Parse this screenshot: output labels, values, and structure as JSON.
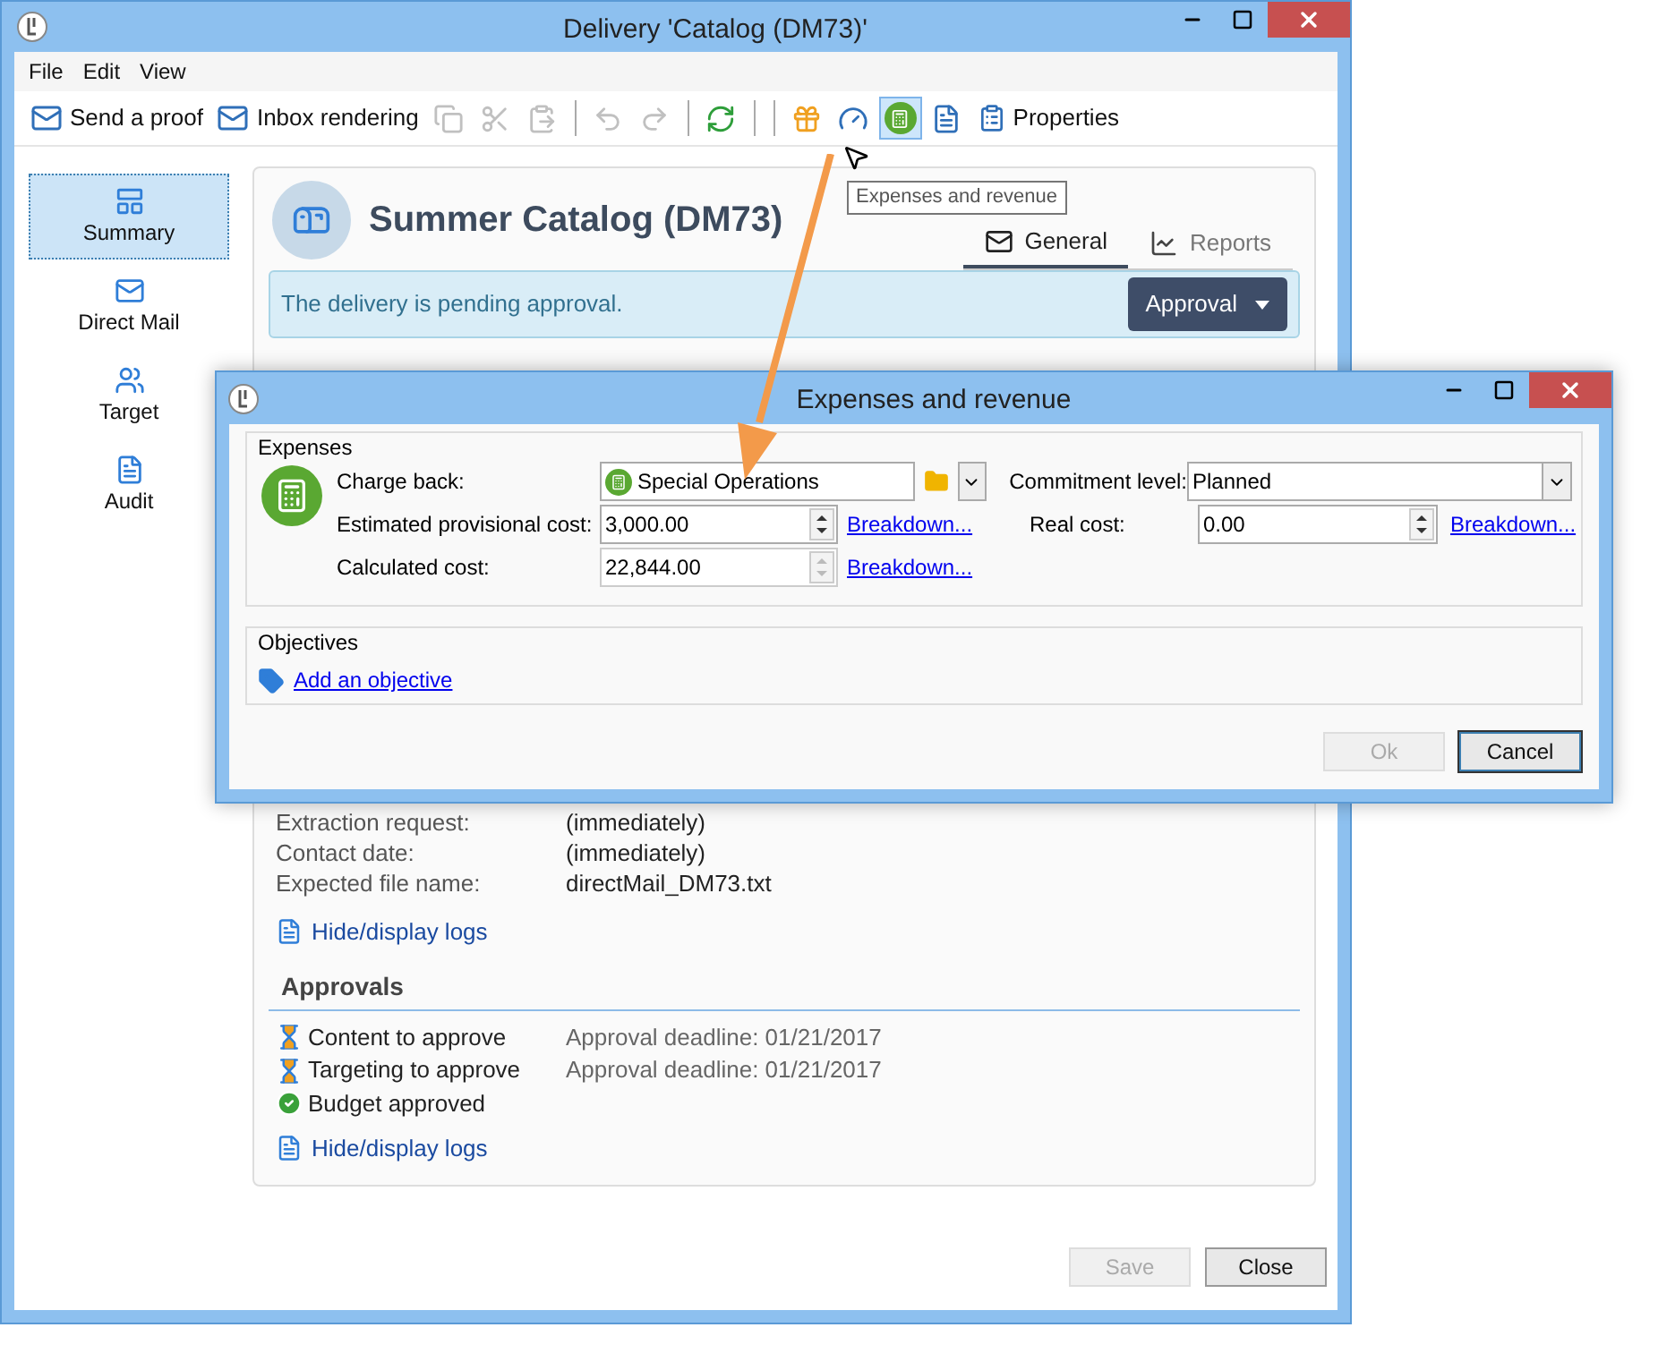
{
  "window": {
    "title": "Delivery 'Catalog (DM73)'"
  },
  "menu": [
    "File",
    "Edit",
    "View"
  ],
  "toolbar": [
    {
      "kind": "button",
      "label": "Send a proof"
    },
    {
      "kind": "button",
      "label": "Inbox rendering"
    },
    {
      "kind": "icon",
      "disabled": true,
      "pressed": false
    },
    {
      "kind": "icon",
      "disabled": true,
      "pressed": false
    },
    {
      "kind": "icon",
      "disabled": true,
      "pressed": false
    },
    {
      "kind": "separator"
    },
    {
      "kind": "icon",
      "disabled": true,
      "pressed": false
    },
    {
      "kind": "icon",
      "disabled": true,
      "pressed": false
    },
    {
      "kind": "separator"
    },
    {
      "kind": "icon",
      "disabled": false,
      "pressed": false
    },
    {
      "kind": "separator"
    },
    {
      "kind": "separator"
    },
    {
      "kind": "icon",
      "disabled": false,
      "pressed": false
    },
    {
      "kind": "icon",
      "disabled": false,
      "pressed": false
    },
    {
      "kind": "icon",
      "disabled": false,
      "pressed": true
    },
    {
      "kind": "icon",
      "disabled": false,
      "pressed": false
    },
    {
      "kind": "button",
      "label": "Properties"
    }
  ],
  "tooltip": "Expenses and revenue",
  "sidebar": {
    "items": [
      {
        "label": "Summary",
        "selected": true
      },
      {
        "label": "Direct Mail",
        "selected": false
      },
      {
        "label": "Target",
        "selected": false
      },
      {
        "label": "Audit",
        "selected": false
      }
    ]
  },
  "summary": {
    "title": "Summer Catalog (DM73)",
    "tabs": [
      {
        "label": "General",
        "selected": true
      },
      {
        "label": "Reports",
        "selected": false
      }
    ],
    "alert": "The delivery is pending approval.",
    "approval_button": "Approval",
    "external_file": {
      "rows": [
        {
          "label": "Extraction request:",
          "value": "(immediately)"
        },
        {
          "label": "Contact date:",
          "value": "(immediately)"
        },
        {
          "label": "Expected file name:",
          "value": "directMail_DM73.txt"
        }
      ],
      "logs_link": "Hide/display logs"
    },
    "approvals": {
      "title": "Approvals",
      "items": [
        {
          "label": "Content to approve",
          "kind": "pending",
          "deadline": "Approval deadline: 01/21/2017"
        },
        {
          "label": "Targeting to approve",
          "kind": "pending",
          "deadline": "Approval deadline: 01/21/2017"
        },
        {
          "label": "Budget approved",
          "kind": "approved"
        }
      ],
      "logs_link": "Hide/display logs"
    }
  },
  "footer": [
    {
      "label": "Save",
      "disabled": true
    },
    {
      "label": "Close",
      "disabled": false
    }
  ],
  "dialog": {
    "title": "Expenses and revenue",
    "expenses": {
      "title": "Expenses",
      "charge_back": {
        "label": "Charge back:",
        "value": "Special Operations"
      },
      "commitment": {
        "label": "Commitment level:",
        "value": "Planned"
      },
      "estimated": {
        "label": "Estimated provisional cost:",
        "value": "3,000.00",
        "link": "Breakdown..."
      },
      "real": {
        "label": "Real cost:",
        "value": "0.00",
        "link": "Breakdown..."
      },
      "calculated": {
        "label": "Calculated cost:",
        "value": "22,844.00",
        "link": "Breakdown...",
        "disabled": true
      }
    },
    "objectives": {
      "title": "Objectives",
      "link": "Add an objective"
    },
    "buttons": [
      {
        "label": "Ok",
        "disabled": true
      },
      {
        "label": "Cancel",
        "disabled": false
      }
    ]
  }
}
